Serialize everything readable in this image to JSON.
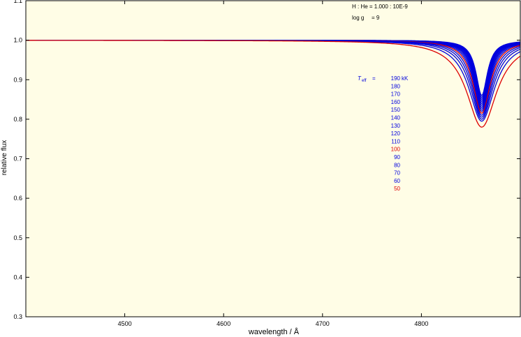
{
  "chart_data": {
    "type": "line",
    "xlabel": "wavelength / Å",
    "ylabel": "relative flux",
    "xlim": [
      4400,
      4900
    ],
    "ylim": [
      0.3,
      1.1
    ],
    "x_ticks": [
      4500,
      4600,
      4700,
      4800
    ],
    "y_ticks": [
      0.3,
      0.4,
      0.5,
      0.6,
      0.7,
      0.8,
      0.9,
      1.0,
      1.1
    ],
    "x_tick_labels": [
      "4500",
      "4600",
      "4700",
      "4800"
    ],
    "y_tick_labels": [
      "0.3",
      "0.4",
      "0.5",
      "0.6",
      "0.7",
      "0.8",
      "0.9",
      "1.0",
      "1.1"
    ],
    "grid": false,
    "background": "#fffde6",
    "annotations": {
      "composition": "H : He = 1.000 : 10E-9",
      "logg_label": "log g",
      "logg_value": "= 9",
      "teff_symbol": "T",
      "teff_subscript": "eff",
      "teff_equals": "=",
      "teff_unit": "kK"
    },
    "line_center": 4861,
    "series": [
      {
        "name": "190",
        "color": "#0000dd",
        "min": 0.86,
        "halfwidth": 7.0
      },
      {
        "name": "180",
        "color": "#0000dd",
        "min": 0.855,
        "halfwidth": 7.2
      },
      {
        "name": "170",
        "color": "#0000dd",
        "min": 0.85,
        "halfwidth": 7.5
      },
      {
        "name": "160",
        "color": "#0000dd",
        "min": 0.845,
        "halfwidth": 7.8
      },
      {
        "name": "150",
        "color": "#0000dd",
        "min": 0.84,
        "halfwidth": 8.1
      },
      {
        "name": "140",
        "color": "#0000dd",
        "min": 0.835,
        "halfwidth": 8.5
      },
      {
        "name": "130",
        "color": "#0000dd",
        "min": 0.83,
        "halfwidth": 8.9
      },
      {
        "name": "120",
        "color": "#0000dd",
        "min": 0.825,
        "halfwidth": 9.4
      },
      {
        "name": "110",
        "color": "#0000dd",
        "min": 0.82,
        "halfwidth": 10.0
      },
      {
        "name": "100",
        "color": "#dd0000",
        "min": 0.815,
        "halfwidth": 10.7
      },
      {
        "name": "90",
        "color": "#0000dd",
        "min": 0.81,
        "halfwidth": 11.6
      },
      {
        "name": "80",
        "color": "#0000dd",
        "min": 0.805,
        "halfwidth": 12.7
      },
      {
        "name": "70",
        "color": "#0000dd",
        "min": 0.8,
        "halfwidth": 14.0
      },
      {
        "name": "60",
        "color": "#0000dd",
        "min": 0.795,
        "halfwidth": 15.8
      },
      {
        "name": "50",
        "color": "#dd0000",
        "min": 0.78,
        "halfwidth": 18.5
      }
    ]
  }
}
